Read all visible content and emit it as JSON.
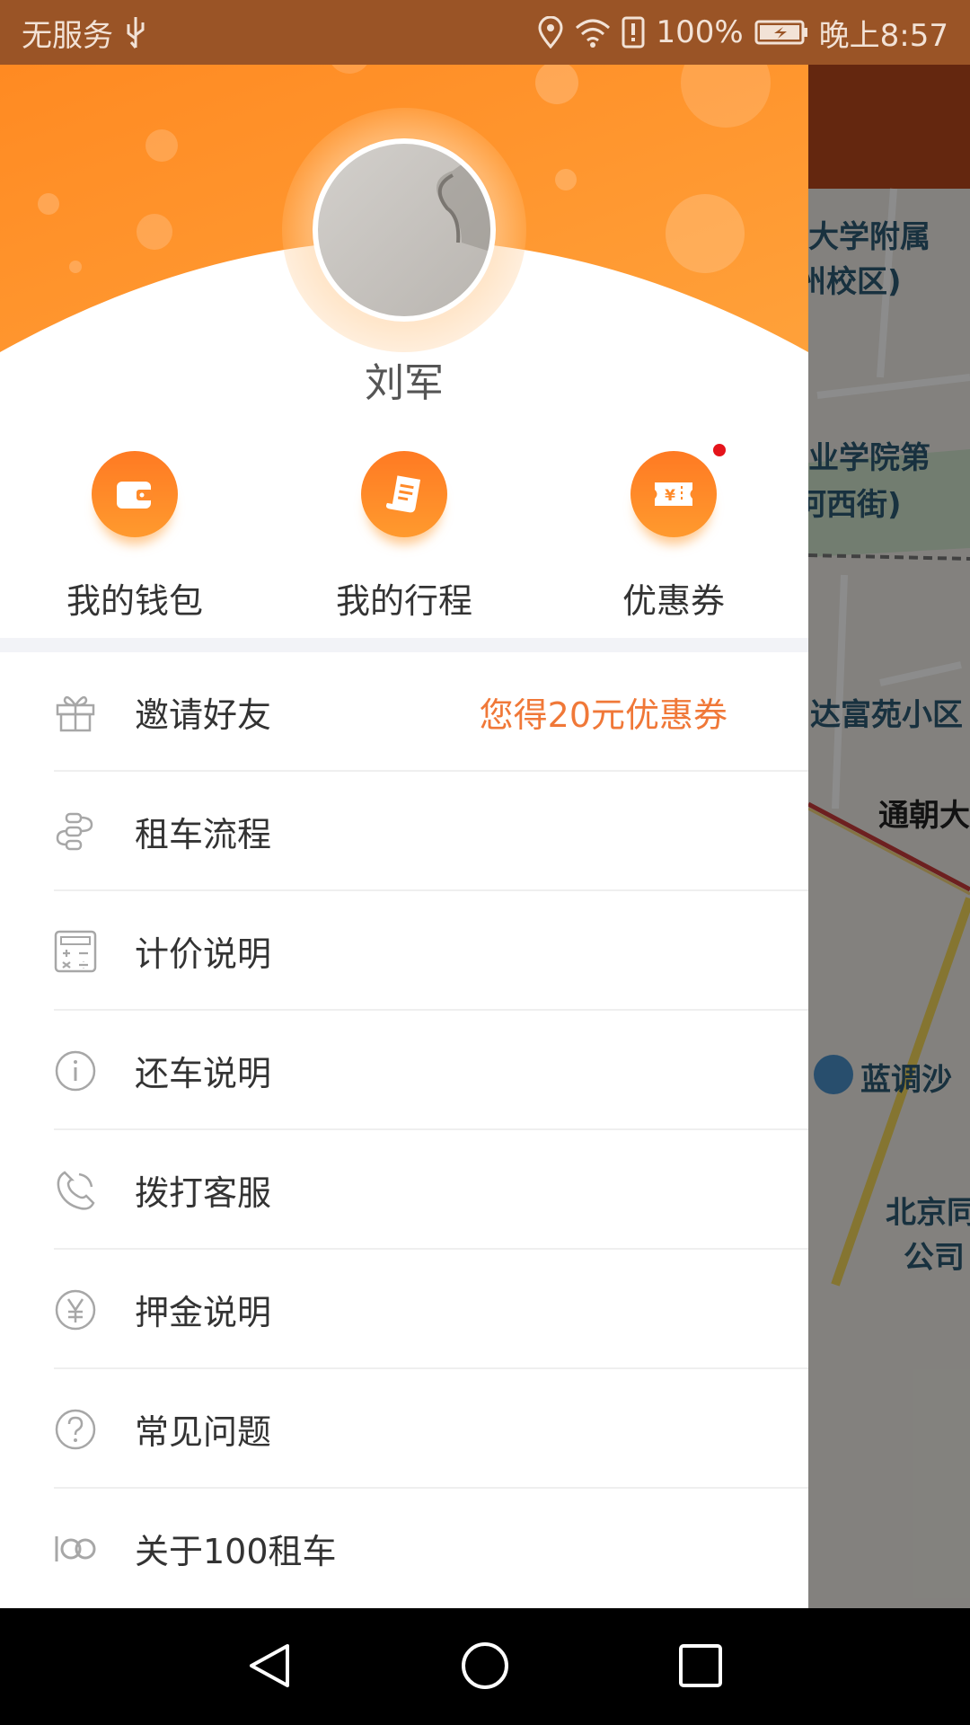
{
  "status_bar": {
    "carrier": "无服务",
    "battery": "100%",
    "time": "晚上8:57"
  },
  "user": {
    "name": "刘军"
  },
  "quick_actions": [
    {
      "label": "我的钱包",
      "icon": "wallet-icon"
    },
    {
      "label": "我的行程",
      "icon": "itinerary-icon"
    },
    {
      "label": "优惠券",
      "icon": "coupon-icon",
      "badge": true
    }
  ],
  "menu": [
    {
      "label": "邀请好友",
      "icon": "gift-icon",
      "promo": "您得20元优惠券"
    },
    {
      "label": "租车流程",
      "icon": "flow-icon"
    },
    {
      "label": "计价说明",
      "icon": "calculator-icon"
    },
    {
      "label": "还车说明",
      "icon": "info-icon"
    },
    {
      "label": "拨打客服",
      "icon": "phone-icon"
    },
    {
      "label": "押金说明",
      "icon": "yuan-icon"
    },
    {
      "label": "常见问题",
      "icon": "question-icon"
    },
    {
      "label": "关于100租车",
      "icon": "logo-100-icon"
    }
  ],
  "map_labels": [
    {
      "text": "大学附属"
    },
    {
      "text": "州校区)"
    },
    {
      "text": "业学院第"
    },
    {
      "text": "河西街)"
    },
    {
      "text": "达富苑小区"
    },
    {
      "text": "通朝大"
    },
    {
      "text": "蓝调沙"
    },
    {
      "text": "北京同"
    },
    {
      "text": "公司"
    }
  ],
  "colors": {
    "accent": "#ff7a23",
    "promo": "#f07838",
    "status_bar": "#9a5426"
  }
}
